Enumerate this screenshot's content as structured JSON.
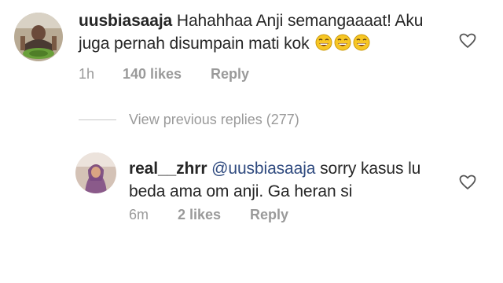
{
  "comments": [
    {
      "username": "uusbiasaaja",
      "text_line1": "Hahahhaa Anji semangaaaat! Aku",
      "text_line2": "juga pernah disumpain mati kok",
      "emoji": [
        "grinning-tears-emoji",
        "grinning-tears-emoji",
        "grinning-tears-emoji"
      ],
      "time": "1h",
      "likes": "140 likes",
      "reply_label": "Reply"
    },
    {
      "username": "real__zhrr",
      "mention": "@uusbiasaaja",
      "text_line1_rest": " sorry kasus lu",
      "text_line2": "beda ama om anji. Ga heran si",
      "time": "6m",
      "likes": "2 likes",
      "reply_label": "Reply"
    }
  ],
  "view_previous_replies": "View previous replies (277)",
  "icons": {
    "like": "heart-outline-icon"
  },
  "colors": {
    "text": "#262626",
    "meta": "#9a9a9a",
    "mention": "#2f4a7f"
  }
}
